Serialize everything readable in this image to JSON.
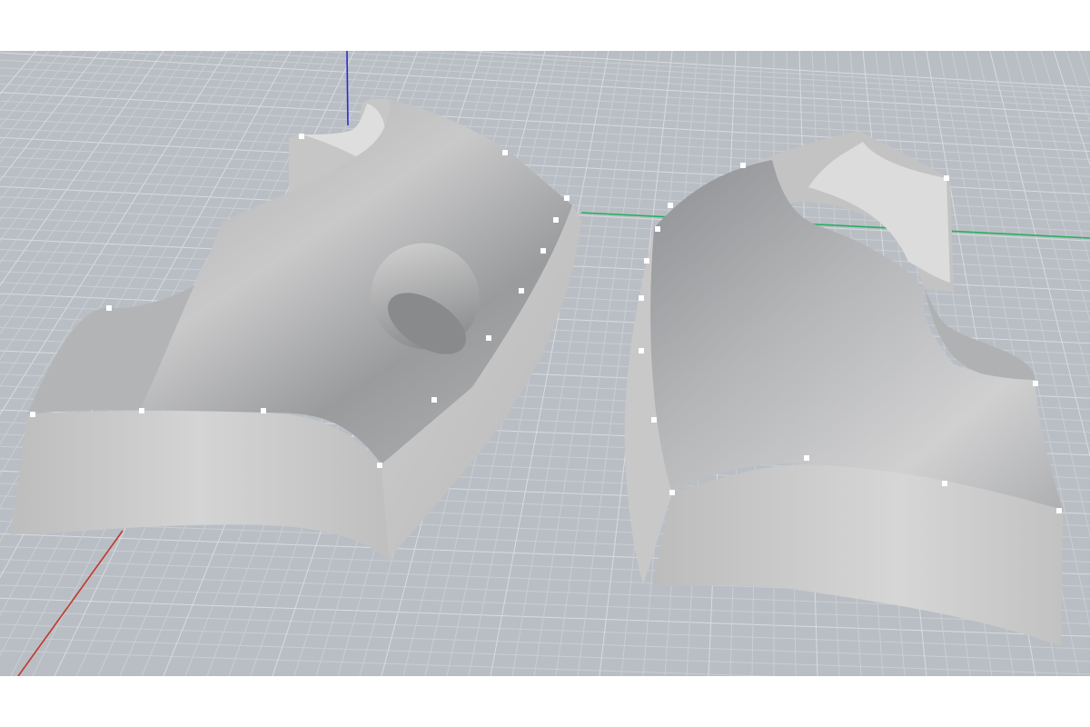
{
  "viewport": {
    "background_color": "#b9bec4",
    "grid_minor_color": "#c9ced3",
    "grid_major_color": "#d8dce0",
    "axis_x_color": "#c0392b",
    "axis_y_color": "#27ae60",
    "axis_z_color": "#2b2bd6"
  },
  "objects": [
    {
      "label": "",
      "color": "#c4c4c4"
    },
    {
      "label": "",
      "color": "#c4c4c4"
    }
  ],
  "control_point_color": "#ffffff"
}
